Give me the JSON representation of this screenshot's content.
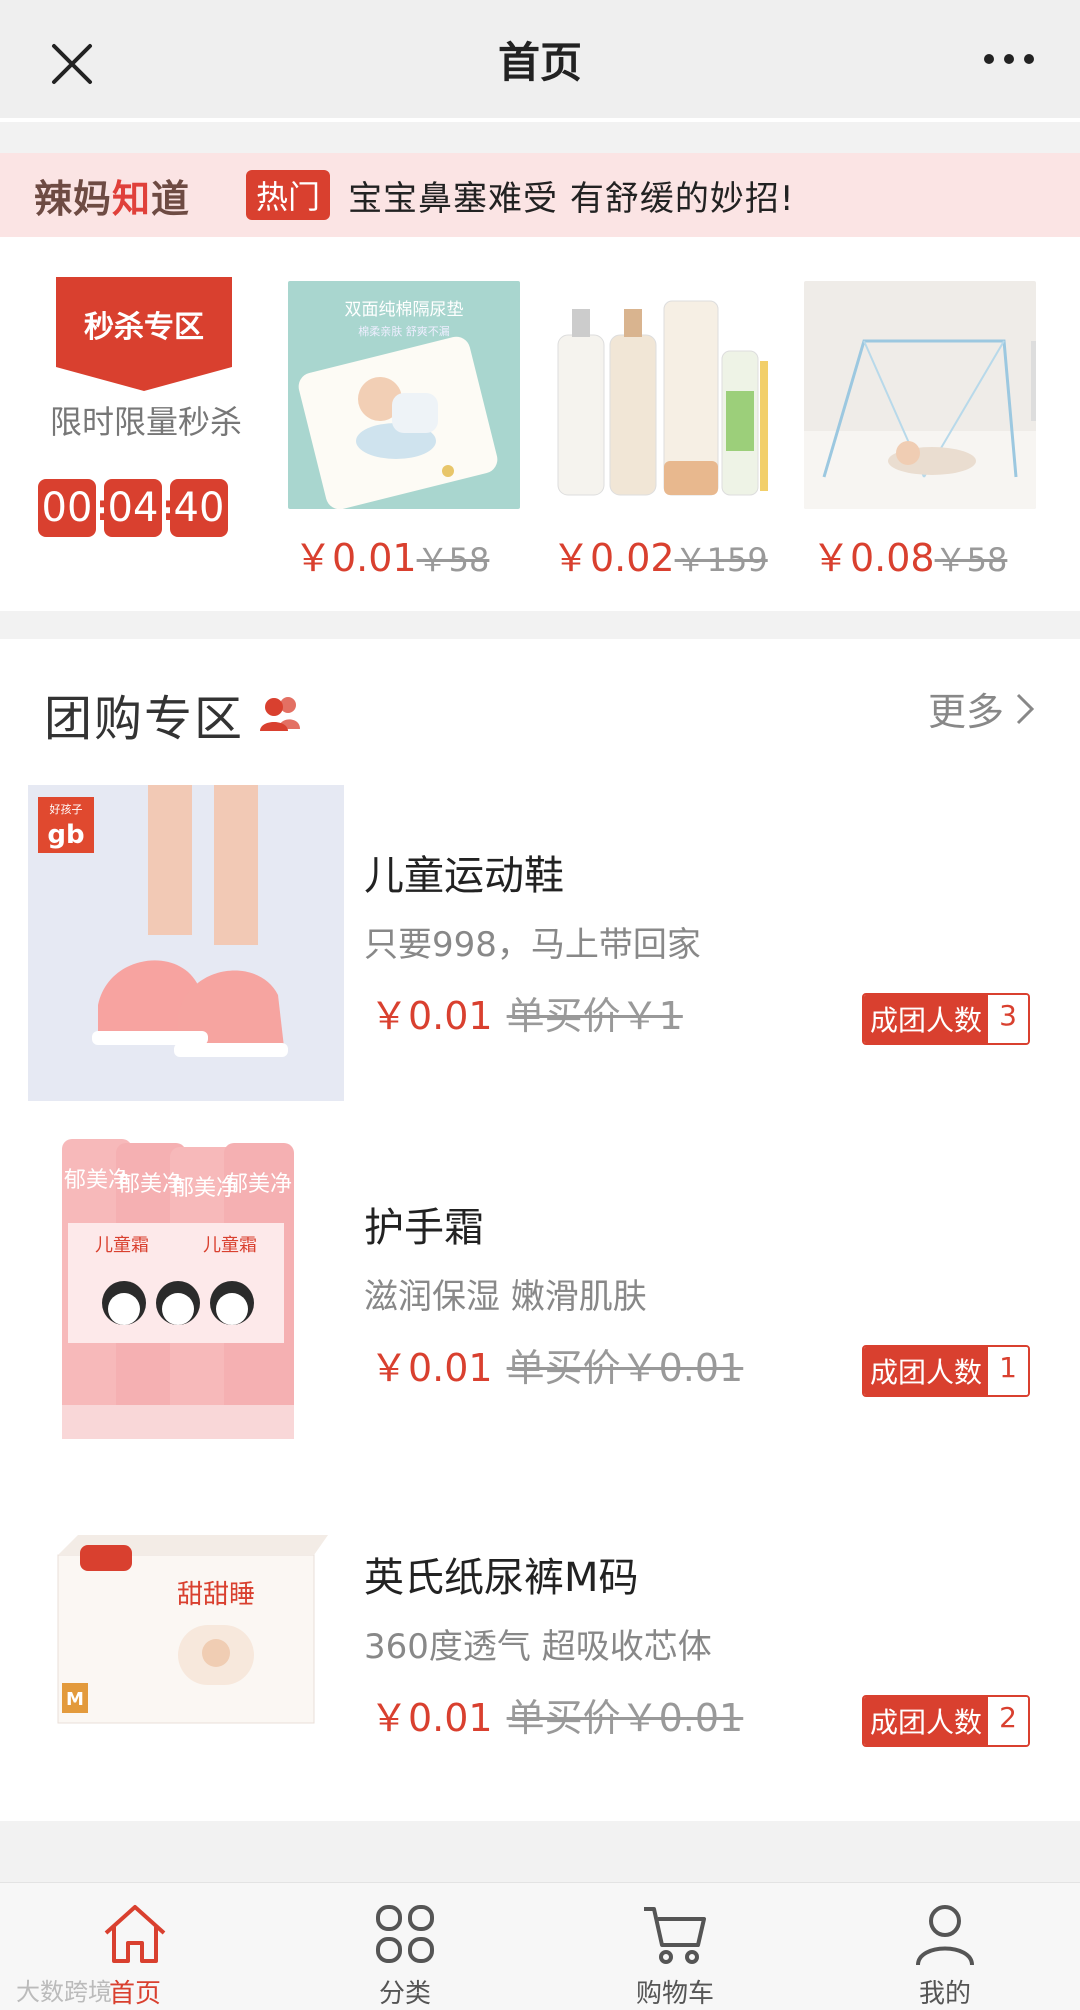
{
  "header": {
    "title": "首页",
    "close_icon": "close-icon",
    "more_icon": "more-dots-icon"
  },
  "news": {
    "brand_a": "辣妈",
    "brand_b": "知",
    "brand_c": "道",
    "tag": "热门",
    "headline": "宝宝鼻塞难受 有舒缓的妙招!"
  },
  "flash_sale": {
    "badge": "秒杀专区",
    "subtitle": "限时限量秒杀",
    "countdown": {
      "h": "00",
      "m": "04",
      "s": "40"
    },
    "items": [
      {
        "image_title": "双面纯棉隔尿垫",
        "image_sub": "棉柔亲肤 舒爽不漏",
        "price": "￥0.01",
        "old_price": "￥58"
      },
      {
        "price": "￥0.02",
        "old_price": "￥159"
      },
      {
        "price": "￥0.08",
        "old_price": "￥58"
      }
    ]
  },
  "group_buy": {
    "title": "团购专区",
    "more": "更多",
    "items": [
      {
        "name": "儿童运动鞋",
        "desc": "只要998，马上带回家",
        "price": "￥0.01",
        "single_price": "单买价￥1",
        "badge_label": "成团人数",
        "count": "3",
        "logo": "gb",
        "logo_top": "好孩子"
      },
      {
        "name": "护手霜",
        "desc": "滋润保湿 嫩滑肌肤",
        "price": "￥0.01",
        "single_price": "单买价￥0.01",
        "badge_label": "成团人数",
        "count": "1",
        "product_text": "郁美净",
        "product_sub": "儿童霜"
      },
      {
        "name": "英氏纸尿裤M码",
        "desc": "360度透气 超吸收芯体",
        "price": "￥0.01",
        "single_price": "单买价￥0.01",
        "badge_label": "成团人数",
        "count": "2",
        "box_text": "甜甜睡",
        "box_size": "M"
      }
    ]
  },
  "tabbar": {
    "items": [
      {
        "label": "首页",
        "icon": "home-icon"
      },
      {
        "label": "分类",
        "icon": "category-icon"
      },
      {
        "label": "购物车",
        "icon": "cart-icon"
      },
      {
        "label": "我的",
        "icon": "user-icon"
      }
    ]
  },
  "watermark": "大数跨境",
  "colors": {
    "accent": "#d9402f",
    "news_bg": "#fbe4e4"
  }
}
